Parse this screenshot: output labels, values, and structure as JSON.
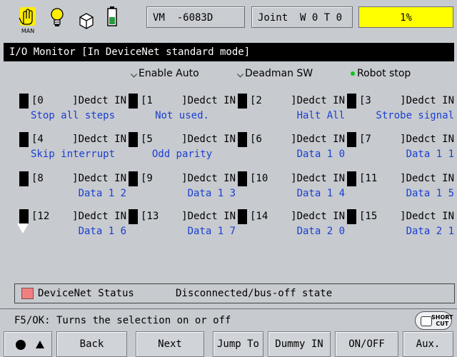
{
  "top": {
    "mode_label": "MAN",
    "program_box": "VM  -6083D",
    "joint_box": "Joint  W 0 T 0",
    "percent": "1%"
  },
  "title": "I/O Monitor [In DeviceNet standard mode]",
  "mode": {
    "enable_auto": "Enable Auto",
    "deadman": "Deadman SW",
    "robot_stop": "Robot stop"
  },
  "io": [
    {
      "num": "[0",
      "type": "]Dedct IN",
      "signal": "Stop all steps"
    },
    {
      "num": "[1",
      "type": "]Dedct IN",
      "signal": "Not used."
    },
    {
      "num": "[2",
      "type": "]Dedct IN",
      "signal": "Halt All"
    },
    {
      "num": "[3",
      "type": "]Dedct IN",
      "signal": "Strobe signal"
    },
    {
      "num": "[4",
      "type": "]Dedct IN",
      "signal": "Skip interrupt"
    },
    {
      "num": "[5",
      "type": "]Dedct IN",
      "signal": "Odd parity"
    },
    {
      "num": "[6",
      "type": "]Dedct IN",
      "signal": "Data 1 0"
    },
    {
      "num": "[7",
      "type": "]Dedct IN",
      "signal": "Data 1 1"
    },
    {
      "num": "[8",
      "type": "]Dedct IN",
      "signal": "Data 1 2"
    },
    {
      "num": "[9",
      "type": "]Dedct IN",
      "signal": "Data 1 3"
    },
    {
      "num": "[10",
      "type": "]Dedct IN",
      "signal": "Data 1 4"
    },
    {
      "num": "[11",
      "type": "]Dedct IN",
      "signal": "Data 1 5"
    },
    {
      "num": "[12",
      "type": "]Dedct IN",
      "signal": "Data 1 6"
    },
    {
      "num": "[13",
      "type": "]Dedct IN",
      "signal": "Data 1 7"
    },
    {
      "num": "[14",
      "type": "]Dedct IN",
      "signal": "Data 2 0"
    },
    {
      "num": "[15",
      "type": "]Dedct IN",
      "signal": "Data 2 1"
    }
  ],
  "status": {
    "label": "DeviceNet Status",
    "value": "Disconnected/bus-off state"
  },
  "hint": "F5/OK: Turns the selection on or off",
  "shortcut": {
    "line1": "SHORT",
    "line2": "CUT"
  },
  "fkeys": [
    "Back",
    "Next",
    "Jump To",
    "Dummy IN",
    "ON/OFF",
    "Aux."
  ],
  "colors": {
    "signal": "#1a3fd0",
    "percent_bg": "#ffff00",
    "status_led": "#f08080",
    "robot_stop_led": "#10c020"
  }
}
